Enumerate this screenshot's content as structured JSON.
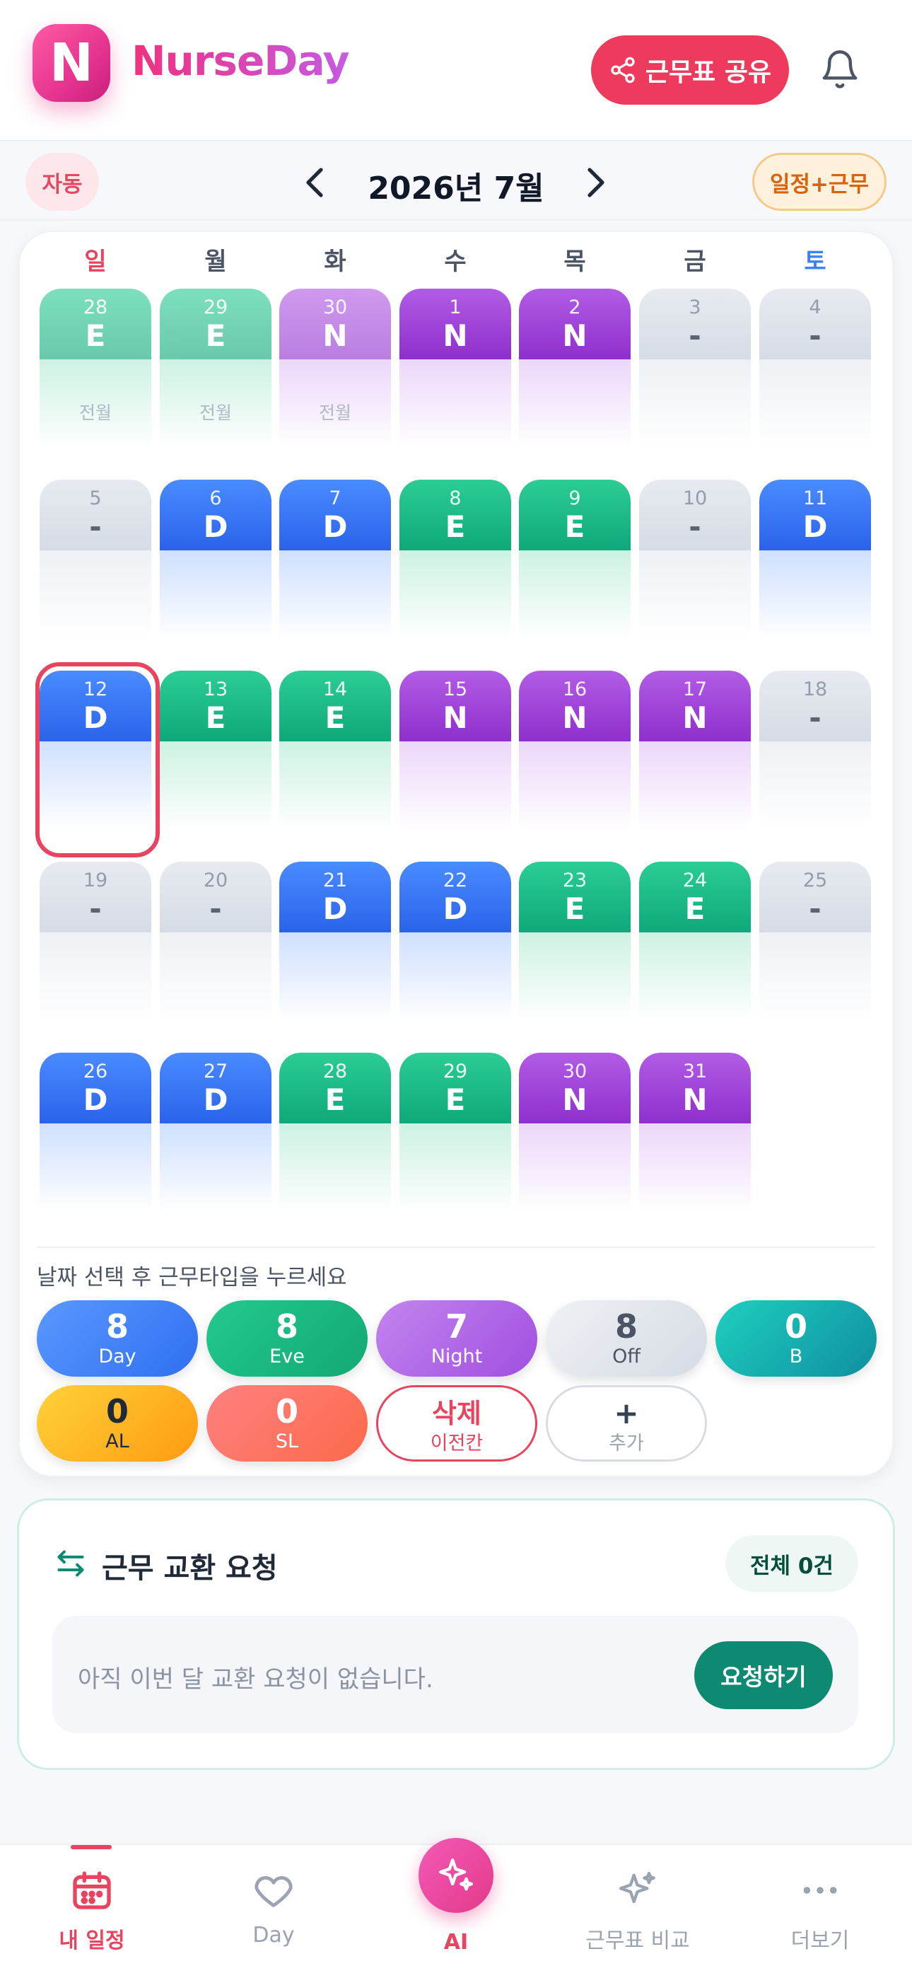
{
  "app": {
    "logo_letter": "N",
    "name": "NurseDay",
    "share_label": "근무표 공유"
  },
  "monthbar": {
    "auto_label": "자동",
    "title": "2026년 7월",
    "mode_label": "일정+근무"
  },
  "weekdays": [
    "일",
    "월",
    "화",
    "수",
    "목",
    "금",
    "토"
  ],
  "weekday_colors": {
    "sun": "#e8445f",
    "sat": "#3b82f6"
  },
  "shift_colors": {
    "D": "#3478f6",
    "E": "#17b985",
    "N": "#a146d8",
    "-": "#dde3ea"
  },
  "calendar": {
    "weeks": [
      [
        {
          "d": "28",
          "s": "E",
          "note": "전월"
        },
        {
          "d": "29",
          "s": "E",
          "note": "전월"
        },
        {
          "d": "30",
          "s": "N",
          "note": "전월"
        },
        {
          "d": "1",
          "s": "N"
        },
        {
          "d": "2",
          "s": "N"
        },
        {
          "d": "3",
          "s": "-"
        },
        {
          "d": "4",
          "s": "-"
        }
      ],
      [
        {
          "d": "5",
          "s": "-"
        },
        {
          "d": "6",
          "s": "D"
        },
        {
          "d": "7",
          "s": "D"
        },
        {
          "d": "8",
          "s": "E"
        },
        {
          "d": "9",
          "s": "E"
        },
        {
          "d": "10",
          "s": "-"
        },
        {
          "d": "11",
          "s": "D"
        }
      ],
      [
        {
          "d": "12",
          "s": "D",
          "selected": true
        },
        {
          "d": "13",
          "s": "E"
        },
        {
          "d": "14",
          "s": "E"
        },
        {
          "d": "15",
          "s": "N"
        },
        {
          "d": "16",
          "s": "N"
        },
        {
          "d": "17",
          "s": "N"
        },
        {
          "d": "18",
          "s": "-"
        }
      ],
      [
        {
          "d": "19",
          "s": "-"
        },
        {
          "d": "20",
          "s": "-"
        },
        {
          "d": "21",
          "s": "D"
        },
        {
          "d": "22",
          "s": "D"
        },
        {
          "d": "23",
          "s": "E"
        },
        {
          "d": "24",
          "s": "E"
        },
        {
          "d": "25",
          "s": "-"
        }
      ],
      [
        {
          "d": "26",
          "s": "D"
        },
        {
          "d": "27",
          "s": "D"
        },
        {
          "d": "28",
          "s": "E"
        },
        {
          "d": "29",
          "s": "E"
        },
        {
          "d": "30",
          "s": "N"
        },
        {
          "d": "31",
          "s": "N"
        }
      ]
    ]
  },
  "picker": {
    "hint": "날짜 선택 후 근무타입을 누르세요",
    "day": {
      "count": "8",
      "label": "Day"
    },
    "eve": {
      "count": "8",
      "label": "Eve"
    },
    "night": {
      "count": "7",
      "label": "Night"
    },
    "off": {
      "count": "8",
      "label": "Off"
    },
    "b": {
      "count": "0",
      "label": "B"
    },
    "al": {
      "count": "0",
      "label": "AL"
    },
    "sl": {
      "count": "0",
      "label": "SL"
    },
    "delete": {
      "title": "삭제",
      "label": "이전칸"
    },
    "add": {
      "title": "+",
      "label": "추가"
    }
  },
  "swap": {
    "title": "근무 교환 요청",
    "count_label": "전체 0건",
    "empty_text": "아직 이번 달 교환 요청이 없습니다.",
    "request_label": "요청하기"
  },
  "nav": {
    "schedule": "내 일정",
    "day": "Day",
    "ai": "AI",
    "compare": "근무표 비교",
    "more": "더보기"
  }
}
